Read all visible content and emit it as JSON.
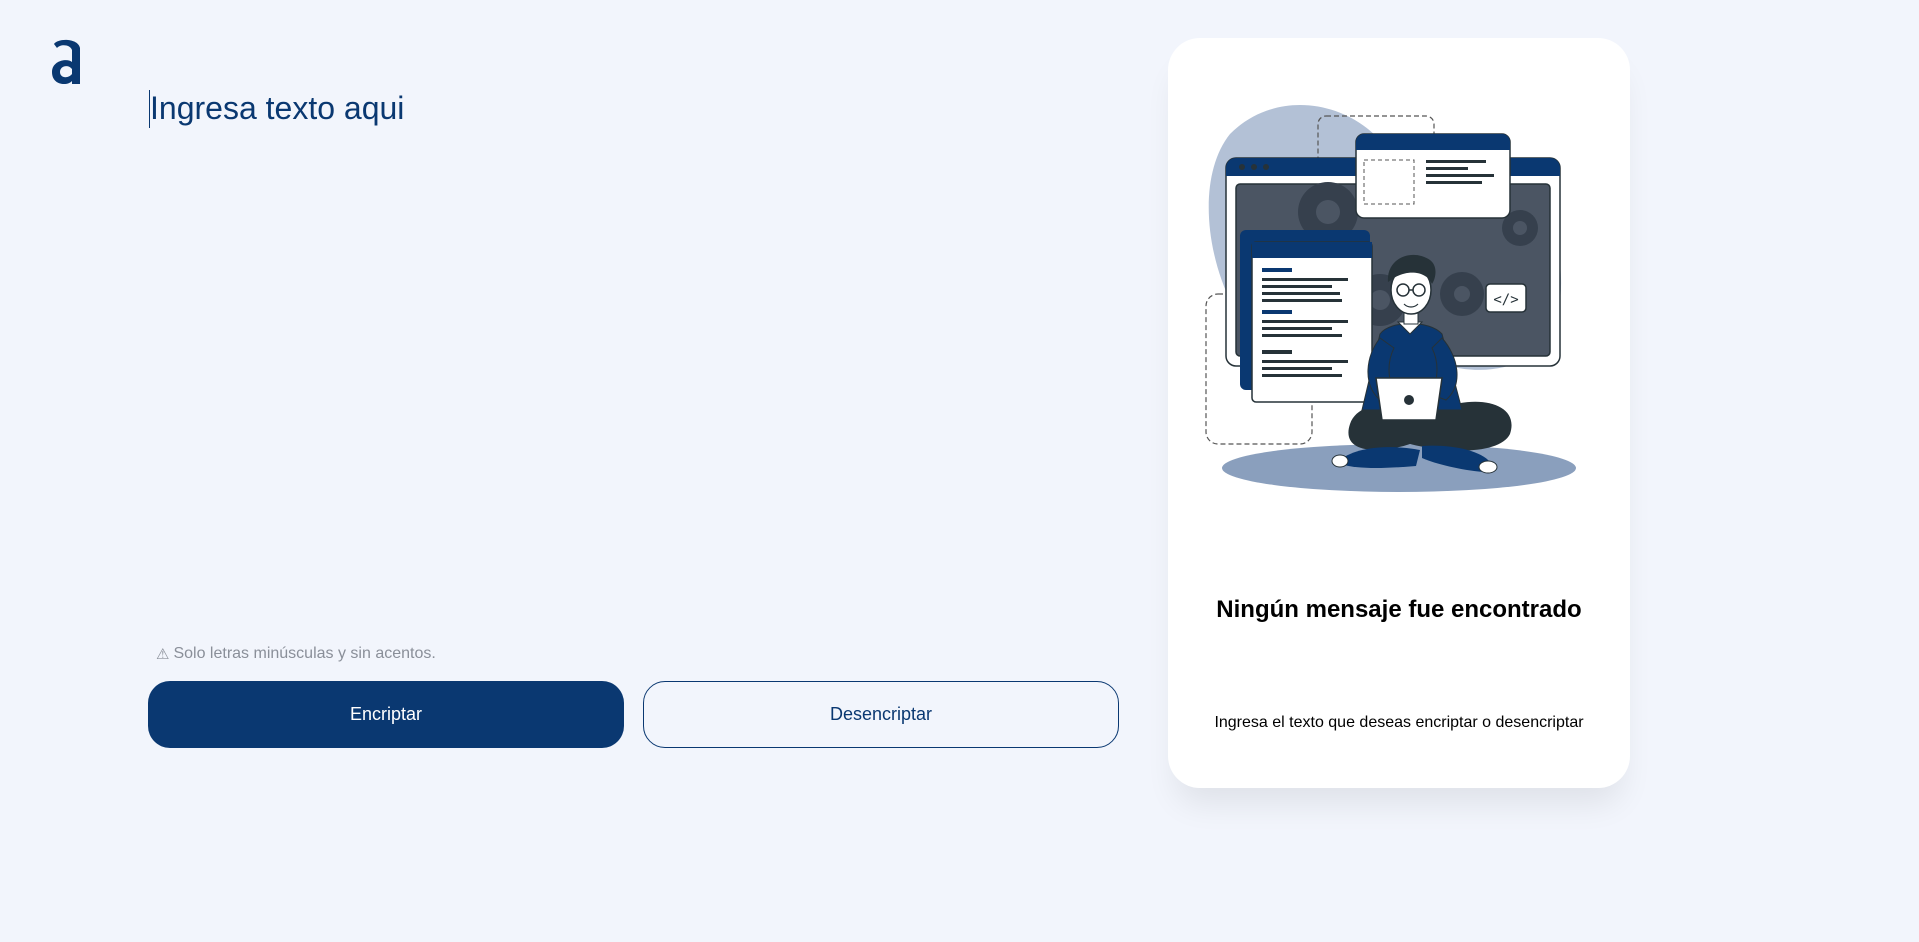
{
  "logo": {
    "icon": "alura-logo-icon",
    "color": "#0a3871"
  },
  "editor": {
    "placeholder": "Ingresa texto aqui"
  },
  "hint": {
    "icon": "warning-icon",
    "text": "Solo letras minúsculas y sin acentos."
  },
  "buttons": {
    "encrypt_label": "Encriptar",
    "decrypt_label": "Desencriptar"
  },
  "output_panel": {
    "illustration": "developer-with-laptop-illustration",
    "title": "Ningún mensaje fue encontrado",
    "subtitle": "Ingresa el texto que deseas encriptar o desencriptar"
  },
  "colors": {
    "primary": "#0a3871",
    "background": "#f2f5fc",
    "card": "#ffffff",
    "hint": "#8a8f99"
  }
}
